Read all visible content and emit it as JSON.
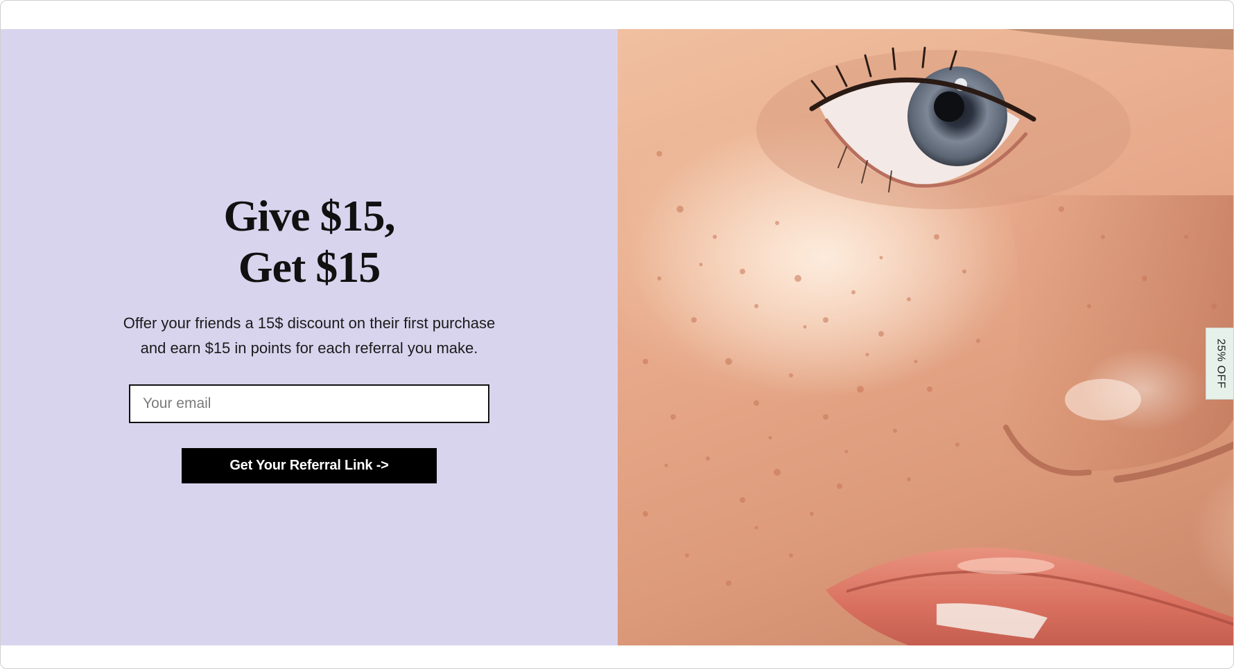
{
  "promo": {
    "headline_line1": "Give $15,",
    "headline_line2": "Get $15",
    "subcopy_line1": "Offer your friends a 15$ discount on their first purchase",
    "subcopy_line2": "and earn $15 in points for each referral you make.",
    "email_placeholder": "Your email",
    "cta_label": "Get Your Referral Link ->",
    "background_color": "#d9d4ee"
  },
  "side_tab": {
    "label": "25% OFF"
  }
}
